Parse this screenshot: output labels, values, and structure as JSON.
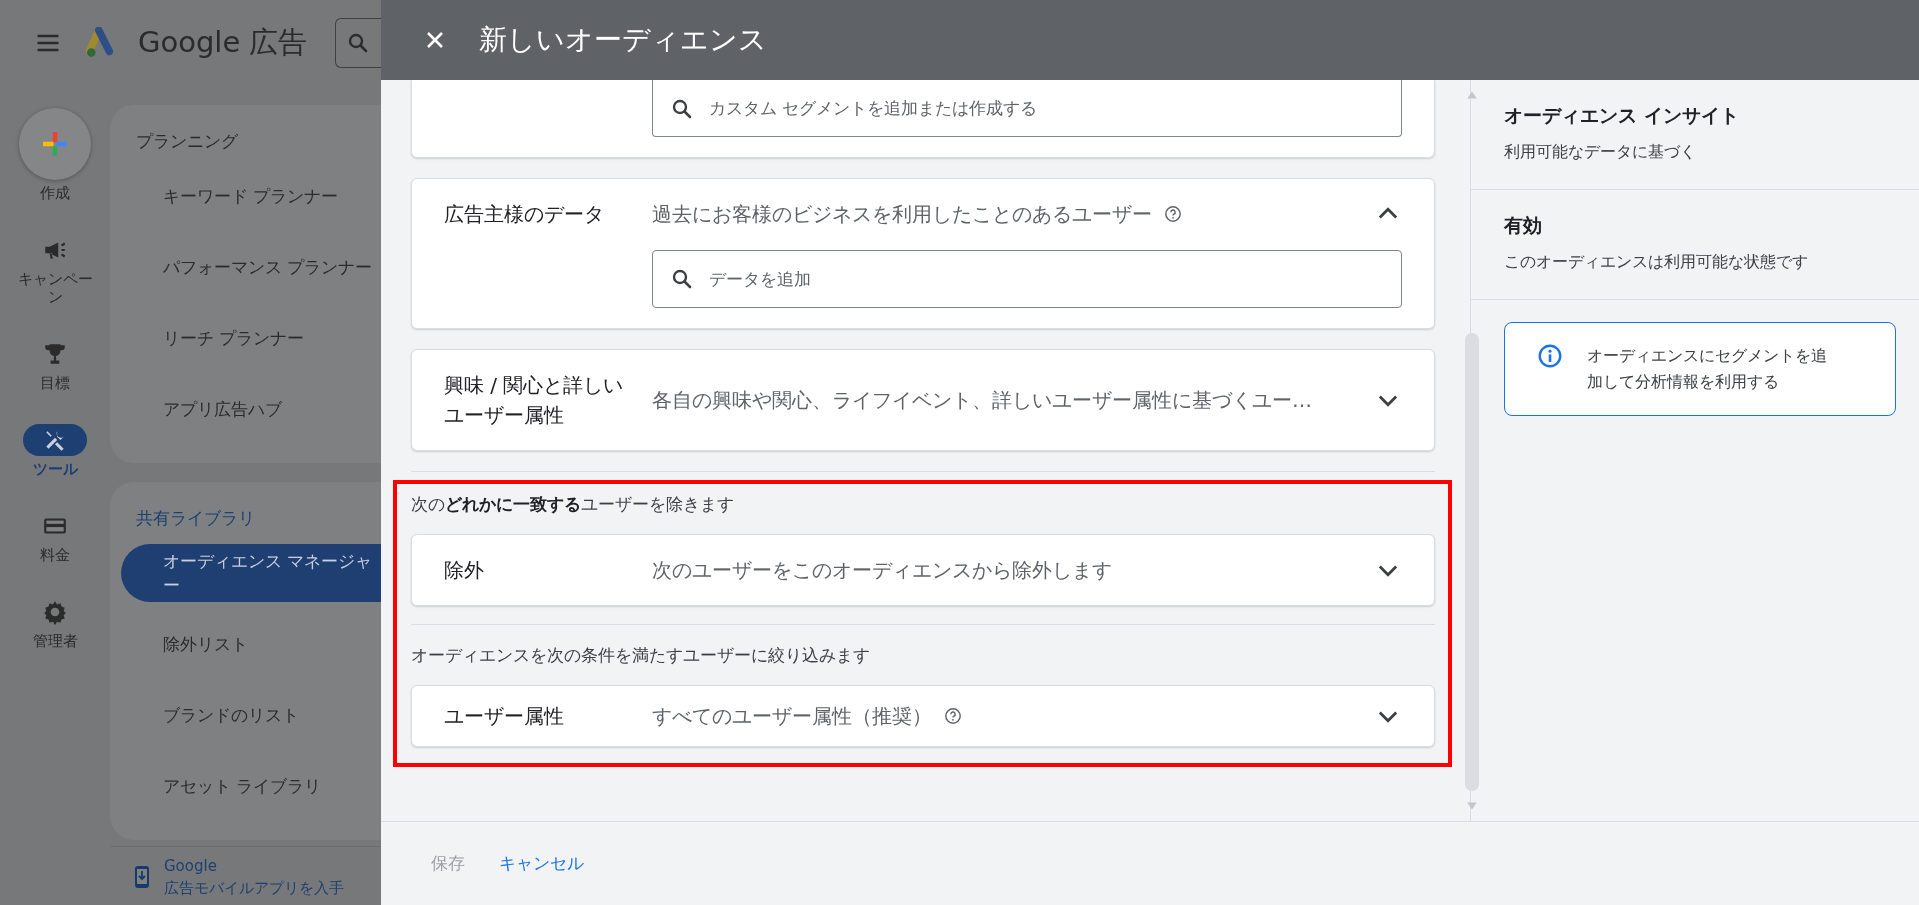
{
  "app": {
    "product_name": "Google 広告",
    "rail": [
      {
        "kind": "create",
        "label": "作成",
        "selected": false
      },
      {
        "kind": "campaign",
        "label": "キャンペーン",
        "selected": false
      },
      {
        "kind": "goal",
        "label": "目標",
        "selected": false
      },
      {
        "kind": "tool",
        "label": "ツール",
        "selected": true
      },
      {
        "kind": "billing",
        "label": "料金",
        "selected": false
      },
      {
        "kind": "admin",
        "label": "管理者",
        "selected": false
      }
    ],
    "nav_sections": [
      {
        "title": "プランニング",
        "items": [
          {
            "label": "キーワード プランナー",
            "selected": false
          },
          {
            "label": "パフォーマンス プランナー",
            "selected": false
          },
          {
            "label": "リーチ プランナー",
            "selected": false
          },
          {
            "label": "アプリ広告ハブ",
            "selected": false
          }
        ]
      },
      {
        "title": "共有ライブラリ",
        "items": [
          {
            "label": "オーディエンス マネージャー",
            "selected": true
          },
          {
            "label": "除外リスト",
            "selected": false
          },
          {
            "label": "ブランドのリスト",
            "selected": false
          },
          {
            "label": "アセット ライブラリ",
            "selected": false
          }
        ]
      }
    ],
    "promo": "Google 広告モバイルアプリを入手"
  },
  "dialog": {
    "title": "新しいオーディエンス",
    "segments": [
      {
        "kind": "partial",
        "placeholder": "カスタム セグメントを追加または作成する"
      },
      {
        "kind": "segment",
        "title": "広告主様のデータ",
        "description": "過去にお客様のビジネスを利用したことのあるユーザー",
        "help": true,
        "expanded": true,
        "placeholder": "データを追加"
      },
      {
        "kind": "segment",
        "title": "興味 / 関心と詳しいユーザー属性",
        "description": "各自の興味や関心、ライフイベント、詳しいユーザー属性に基づくユー…",
        "help": false,
        "expanded": false
      }
    ],
    "filters": {
      "highlighted": true,
      "groups": [
        {
          "note": "次の**どれかに一致する**ユーザーを除きます",
          "card": {
            "title": "除外",
            "description": "次のユーザーをこのオーディエンスから除外します",
            "help": false,
            "expanded": false
          }
        },
        {
          "note": "オーディエンスを次の条件を満たすユーザーに絞り込みます",
          "card": {
            "title": "ユーザー属性",
            "description": "すべてのユーザー属性（推奨）",
            "help": true,
            "expanded": false
          }
        }
      ]
    },
    "insights": {
      "title": "オーディエンス インサイト",
      "subtitle": "利用可能なデータに基づく",
      "status_title": "有効",
      "status_text": "このオーディエンスは利用可能な状態です",
      "info": "オーディエンスにセグメントを追加して分析情報を利用する"
    },
    "footer": {
      "save": {
        "label": "保存",
        "disabled": true
      },
      "cancel": {
        "label": "キャンセル",
        "disabled": false
      }
    }
  }
}
